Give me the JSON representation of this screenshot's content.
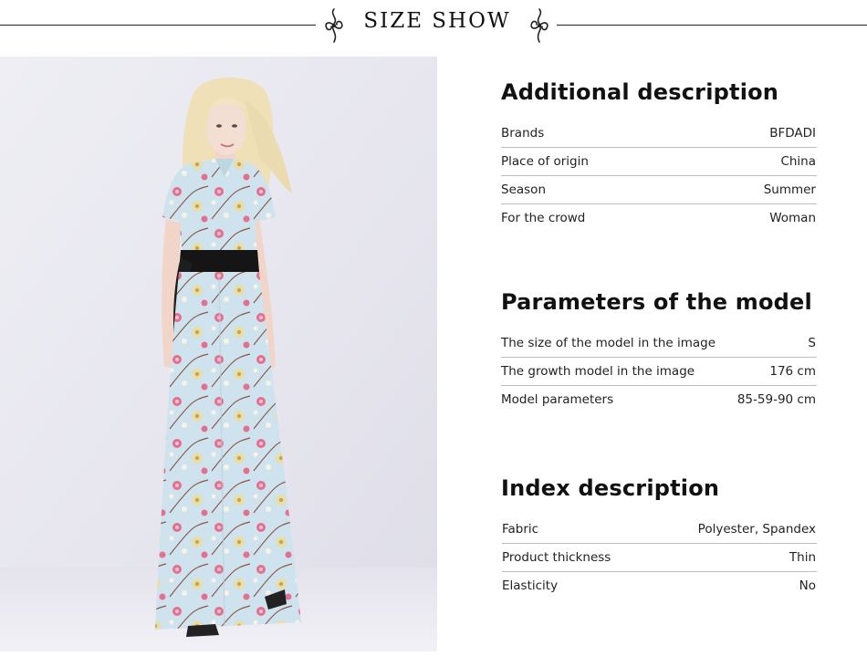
{
  "header": {
    "title": "SIZE SHOW"
  },
  "sections": [
    {
      "title": "Additional description",
      "rows": [
        {
          "label": "Brands",
          "value": "BFDADI"
        },
        {
          "label": "Place of origin",
          "value": "China"
        },
        {
          "label": "Season",
          "value": "Summer"
        },
        {
          "label": "For the crowd",
          "value": "Woman"
        }
      ]
    },
    {
      "title": "Parameters of the model",
      "rows": [
        {
          "label": "The size of the model in the image",
          "value": "S"
        },
        {
          "label": "The growth model in the image",
          "value": "176 cm"
        },
        {
          "label": "Model parameters",
          "value": "85-59-90 cm"
        }
      ]
    },
    {
      "title": "Index description",
      "rows": [
        {
          "label": "Fabric",
          "value": "Polyester, Spandex"
        },
        {
          "label": "Product thickness",
          "value": "Thin"
        },
        {
          "label": "Elasticity",
          "value": "No"
        }
      ]
    }
  ],
  "colors": {
    "dress": "#cfe3ee",
    "belt": "#151515",
    "flower_pink": "#e56f8f",
    "flower_cream": "#e8dfa8",
    "hair": "#efe0b8"
  },
  "icons": {
    "ornament": "flourish-ornament-icon"
  }
}
